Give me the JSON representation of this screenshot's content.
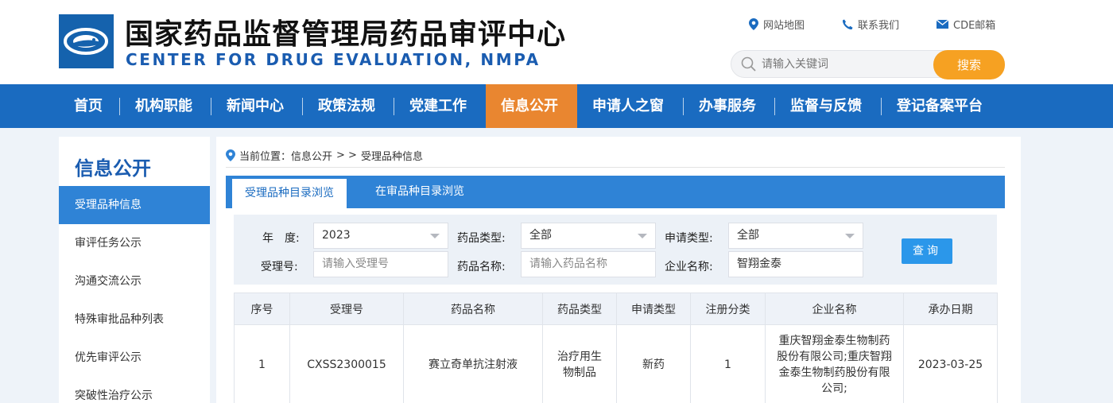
{
  "header": {
    "title_cn": "国家药品监督管理局药品审评中心",
    "title_en": "CENTER FOR DRUG EVALUATION, NMPA",
    "links": [
      {
        "label": "网站地图",
        "icon": "location-pin-icon"
      },
      {
        "label": "联系我们",
        "icon": "phone-icon"
      },
      {
        "label": "CDE邮箱",
        "icon": "mail-icon"
      }
    ],
    "search": {
      "placeholder": "请输入关键词",
      "button": "搜索"
    }
  },
  "nav": {
    "items": [
      "首页",
      "机构职能",
      "新闻中心",
      "政策法规",
      "党建工作",
      "信息公开",
      "申请人之窗",
      "办事服务",
      "监督与反馈",
      "登记备案平台"
    ],
    "active": "信息公开",
    "active_color": "#e98630",
    "bg_color": "#1a6bc0"
  },
  "sidebar": {
    "title": "信息公开",
    "items": [
      "受理品种信息",
      "审评任务公示",
      "沟通交流公示",
      "特殊审批品种列表",
      "优先审评公示",
      "突破性治疗公示"
    ],
    "active": "受理品种信息"
  },
  "breadcrumb": {
    "prefix": "当前位置：信息公开",
    "sep": "> >",
    "current": "受理品种信息"
  },
  "tabs": [
    "受理品种目录浏览",
    "在审品种目录浏览"
  ],
  "filter": {
    "year_label": "年　度:",
    "year_value": "2023",
    "drug_type_label": "药品类型:",
    "drug_type_value": "全部",
    "apply_type_label": "申请类型:",
    "apply_type_value": "全部",
    "accept_no_label": "受理号:",
    "accept_no_placeholder": "请输入受理号",
    "drug_name_label": "药品名称:",
    "drug_name_placeholder": "请输入药品名称",
    "company_label": "企业名称:",
    "company_value": "智翔金泰",
    "query_button": "查询"
  },
  "table": {
    "headers": [
      "序号",
      "受理号",
      "药品名称",
      "药品类型",
      "申请类型",
      "注册分类",
      "企业名称",
      "承办日期"
    ],
    "rows": [
      [
        "1",
        "CXSS2300015",
        "赛立奇单抗注射液",
        "治疗用生物制品",
        "新药",
        "1",
        "重庆智翔金泰生物制药股份有限公司;重庆智翔金泰生物制药股份有限公司;",
        "2023-03-25"
      ]
    ]
  }
}
